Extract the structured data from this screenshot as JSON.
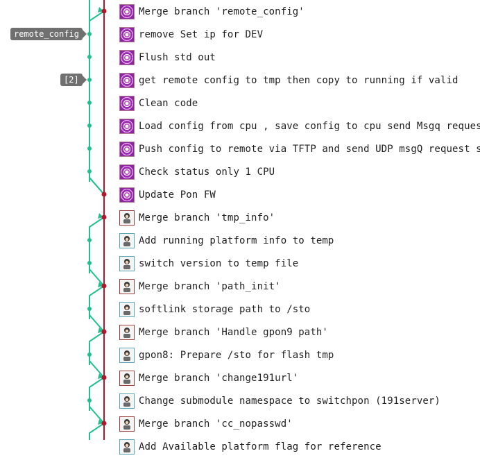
{
  "colors": {
    "graph_green": "#1fbf8f",
    "graph_red": "#b3162d",
    "tag_bg": "#707070"
  },
  "tags": [
    {
      "label": "remote_config",
      "row": 1
    },
    {
      "label": "[2]",
      "row": 3
    }
  ],
  "commits": [
    {
      "message": "Merge branch 'remote_config'",
      "avatar": "purple",
      "merge": true
    },
    {
      "message": "remove Set ip for DEV",
      "avatar": "purple",
      "merge": false
    },
    {
      "message": "Flush std out",
      "avatar": "purple",
      "merge": false
    },
    {
      "message": "get remote config to tmp then copy to running if valid",
      "avatar": "purple",
      "merge": false
    },
    {
      "message": "Clean code",
      "avatar": "purple",
      "merge": false
    },
    {
      "message": "Load config from cpu , save config to cpu send Msgq request",
      "avatar": "purple",
      "merge": false
    },
    {
      "message": "Push config to remote via TFTP and send UDP msgQ request so",
      "avatar": "purple",
      "merge": false
    },
    {
      "message": "Check status only 1 CPU",
      "avatar": "purple",
      "merge": false
    },
    {
      "message": "Update Pon FW",
      "avatar": "purple",
      "merge": false
    },
    {
      "message": "Merge branch 'tmp_info'",
      "avatar": "person",
      "merge": true
    },
    {
      "message": "Add running platform info to temp",
      "avatar": "person-alt",
      "merge": false
    },
    {
      "message": "switch version to temp file",
      "avatar": "person-alt",
      "merge": false
    },
    {
      "message": "Merge branch 'path_init'",
      "avatar": "person",
      "merge": true
    },
    {
      "message": "softlink storage path to /sto",
      "avatar": "person-alt",
      "merge": false
    },
    {
      "message": "Merge branch 'Handle gpon9 path'",
      "avatar": "person",
      "merge": true
    },
    {
      "message": "gpon8: Prepare /sto for flash tmp",
      "avatar": "person-alt",
      "merge": false
    },
    {
      "message": "Merge branch 'change191url'",
      "avatar": "person",
      "merge": true
    },
    {
      "message": "Change submodule namespace to switchpon (191server)",
      "avatar": "person-alt",
      "merge": false
    },
    {
      "message": "Merge branch 'cc_nopasswd'",
      "avatar": "person",
      "merge": true
    },
    {
      "message": "Add Available platform flag for reference",
      "avatar": "person-alt",
      "merge": false
    }
  ]
}
